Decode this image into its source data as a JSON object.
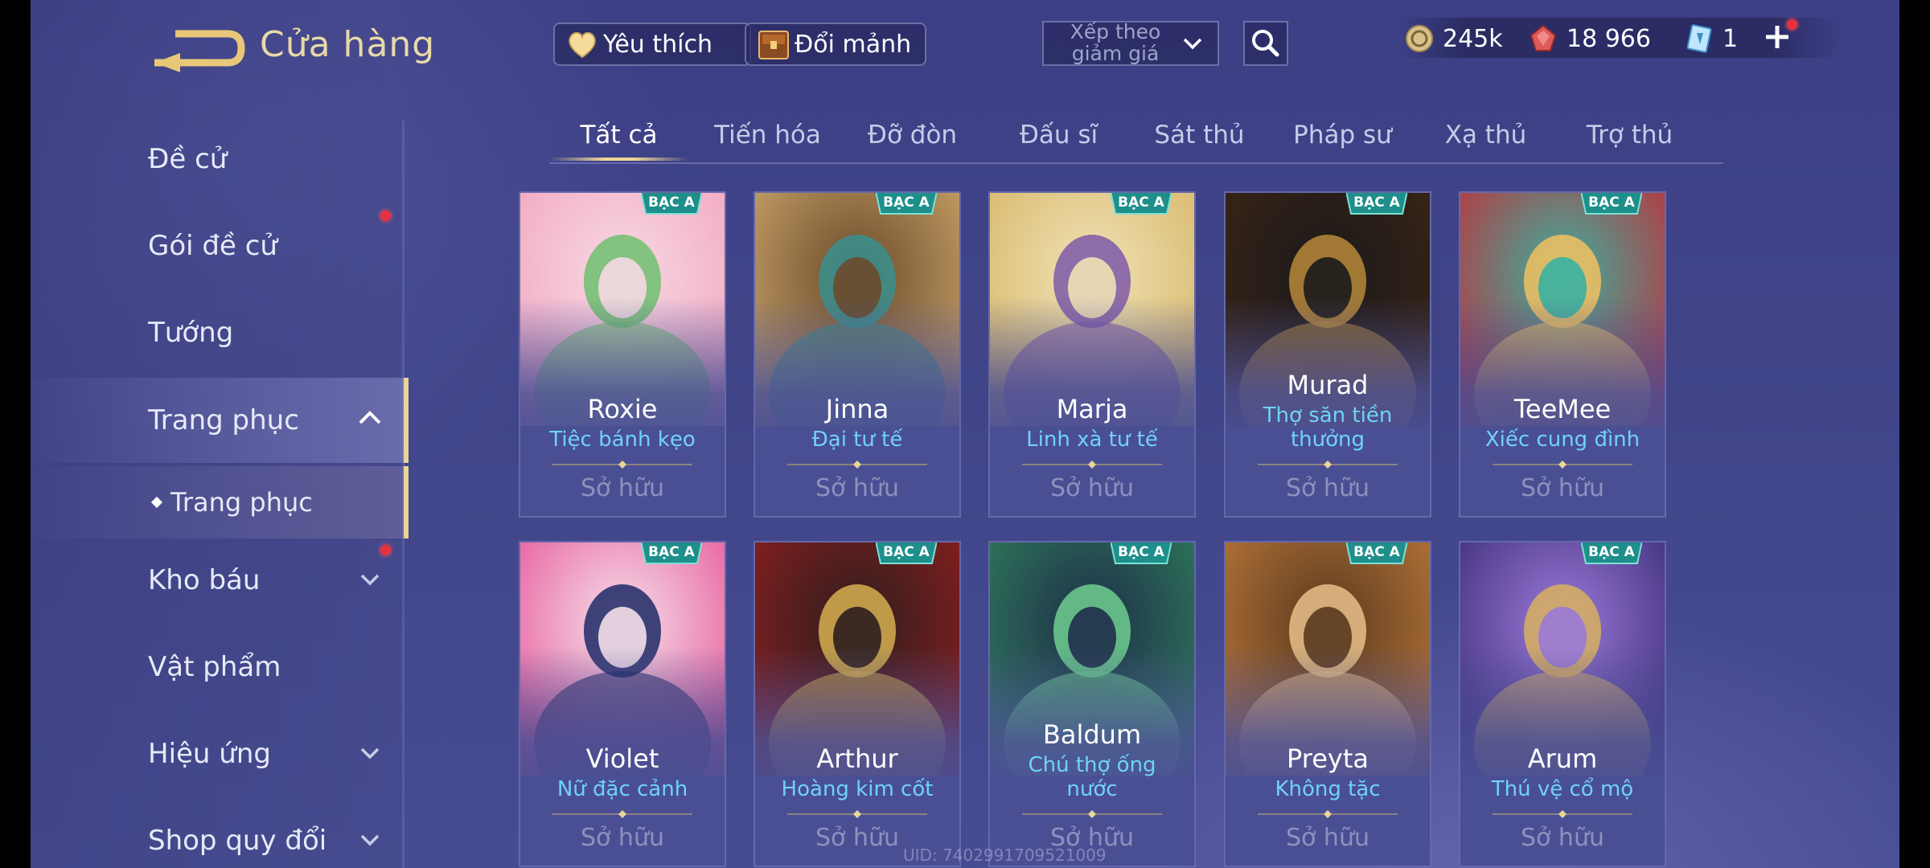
{
  "header": {
    "title": "Cửa hàng",
    "favorites_label": "Yêu thích",
    "exchange_label": "Đổi mảnh",
    "sort_label": "Xếp theo giảm giá"
  },
  "currencies": {
    "gold": "245k",
    "rubies": "18 966",
    "vouchers": "1"
  },
  "sidebar": {
    "items": [
      {
        "label": "Đề cử"
      },
      {
        "label": "Gói đề cử"
      },
      {
        "label": "Tướng"
      },
      {
        "label": "Trang phục"
      },
      {
        "label": "Trang phục"
      },
      {
        "label": "Kho báu"
      },
      {
        "label": "Vật phẩm"
      },
      {
        "label": "Hiệu ứng"
      },
      {
        "label": "Shop quy đổi"
      }
    ]
  },
  "tabs": [
    {
      "label": "Tất cả"
    },
    {
      "label": "Tiến hóa"
    },
    {
      "label": "Đỡ đòn"
    },
    {
      "label": "Đấu sĩ"
    },
    {
      "label": "Sát thủ"
    },
    {
      "label": "Pháp sư"
    },
    {
      "label": "Xạ thủ"
    },
    {
      "label": "Trợ thủ"
    }
  ],
  "rank_label": "BẠC A",
  "owned_label": "Sở hữu",
  "cards": [
    {
      "hero": "Roxie",
      "skin": "Tiệc bánh kẹo"
    },
    {
      "hero": "Jinna",
      "skin": "Đại tư tế"
    },
    {
      "hero": "Marja",
      "skin": "Linh xà tư tế"
    },
    {
      "hero": "Murad",
      "skin": "Thợ săn tiền thưởng"
    },
    {
      "hero": "TeeMee",
      "skin": "Xiếc cung đình"
    },
    {
      "hero": "Violet",
      "skin": "Nữ đặc cảnh"
    },
    {
      "hero": "Arthur",
      "skin": "Hoàng kim cốt"
    },
    {
      "hero": "Baldum",
      "skin": "Chú thợ ống nước"
    },
    {
      "hero": "Preyta",
      "skin": "Không tặc"
    },
    {
      "hero": "Arum",
      "skin": "Thú vệ cổ mộ"
    }
  ],
  "watermark": "UID: 7402991709521009",
  "colors": {
    "accent_gold": "#e8d59a",
    "skin_name_blue": "#6fd2f7",
    "notification_red": "#e6323e"
  }
}
